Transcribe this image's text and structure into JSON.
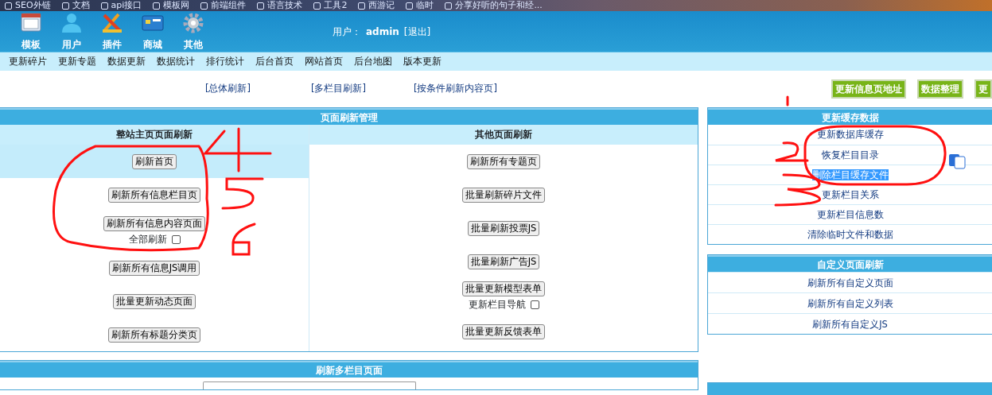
{
  "bookmarks": [
    {
      "label": "SEO外链"
    },
    {
      "label": "文档"
    },
    {
      "label": "api接口"
    },
    {
      "label": "模板网"
    },
    {
      "label": "前端组件"
    },
    {
      "label": "语言技术"
    },
    {
      "label": "工具2"
    },
    {
      "label": "西游记"
    },
    {
      "label": "临时"
    },
    {
      "label": "分享好听的句子和经..."
    }
  ],
  "toolbar": {
    "items": [
      {
        "label": "模板",
        "kind": "window"
      },
      {
        "label": "用户",
        "kind": "user"
      },
      {
        "label": "插件",
        "kind": "tools"
      },
      {
        "label": "商城",
        "kind": "card"
      },
      {
        "label": "其他",
        "kind": "gear"
      }
    ],
    "user_label": "用户：",
    "user": "admin",
    "logout": "[退出]"
  },
  "nav": [
    "更新碎片",
    "更新专题",
    "数据更新",
    "数据统计",
    "排行统计",
    "后台首页",
    "网站首页",
    "后台地图",
    "版本更新"
  ],
  "quick_links": [
    "[总体刷新]",
    "[多栏目刷新]",
    "[按条件刷新内容页]"
  ],
  "action_buttons": [
    "更新信息页地址",
    "数据整理",
    "更"
  ],
  "page_refresh": {
    "title": "页面刷新管理",
    "columns": [
      {
        "heading": "整站主页页面刷新",
        "rows": [
          {
            "button": "刷新首页",
            "selected": true
          },
          {
            "button": "刷新所有信息栏目页",
            "selected": false
          },
          {
            "button": "刷新所有信息内容页面",
            "selected": false,
            "checkbox": {
              "label": "全部刷新",
              "checked": false
            }
          },
          {
            "button": "刷新所有信息JS调用",
            "selected": false
          },
          {
            "button": "批量更新动态页面",
            "selected": false
          },
          {
            "button": "刷新所有标题分类页",
            "selected": false
          }
        ]
      },
      {
        "heading": "其他页面刷新",
        "rows": [
          {
            "button": "刷新所有专题页",
            "selected": false
          },
          {
            "button": "批量刷新碎片文件",
            "selected": false
          },
          {
            "button": "批量刷新投票JS",
            "selected": false
          },
          {
            "button": "批量刷新广告JS",
            "selected": false
          },
          {
            "button": "批量更新模型表单",
            "selected": false,
            "checkbox": {
              "label": "更新栏目导航",
              "checked": false
            }
          },
          {
            "button": "批量更新反馈表单",
            "selected": false
          }
        ]
      }
    ]
  },
  "cache_panel": {
    "title": "更新缓存数据",
    "items": [
      {
        "label": "更新数据库缓存",
        "highlighted": false
      },
      {
        "label": "恢复栏目目录",
        "highlighted": false
      },
      {
        "label": "删除栏目缓存文件",
        "highlighted": true
      },
      {
        "label": "更新栏目关系",
        "highlighted": false
      },
      {
        "label": "更新栏目信息数",
        "highlighted": false
      },
      {
        "label": "清除临时文件和数据",
        "highlighted": false
      }
    ]
  },
  "custom_panel": {
    "title": "自定义页面刷新",
    "items": [
      {
        "label": "刷新所有自定义页面"
      },
      {
        "label": "刷新所有自定义列表"
      },
      {
        "label": "刷新所有自定义JS"
      }
    ]
  },
  "multi_column_panel": {
    "title": "刷新多栏目页面"
  }
}
